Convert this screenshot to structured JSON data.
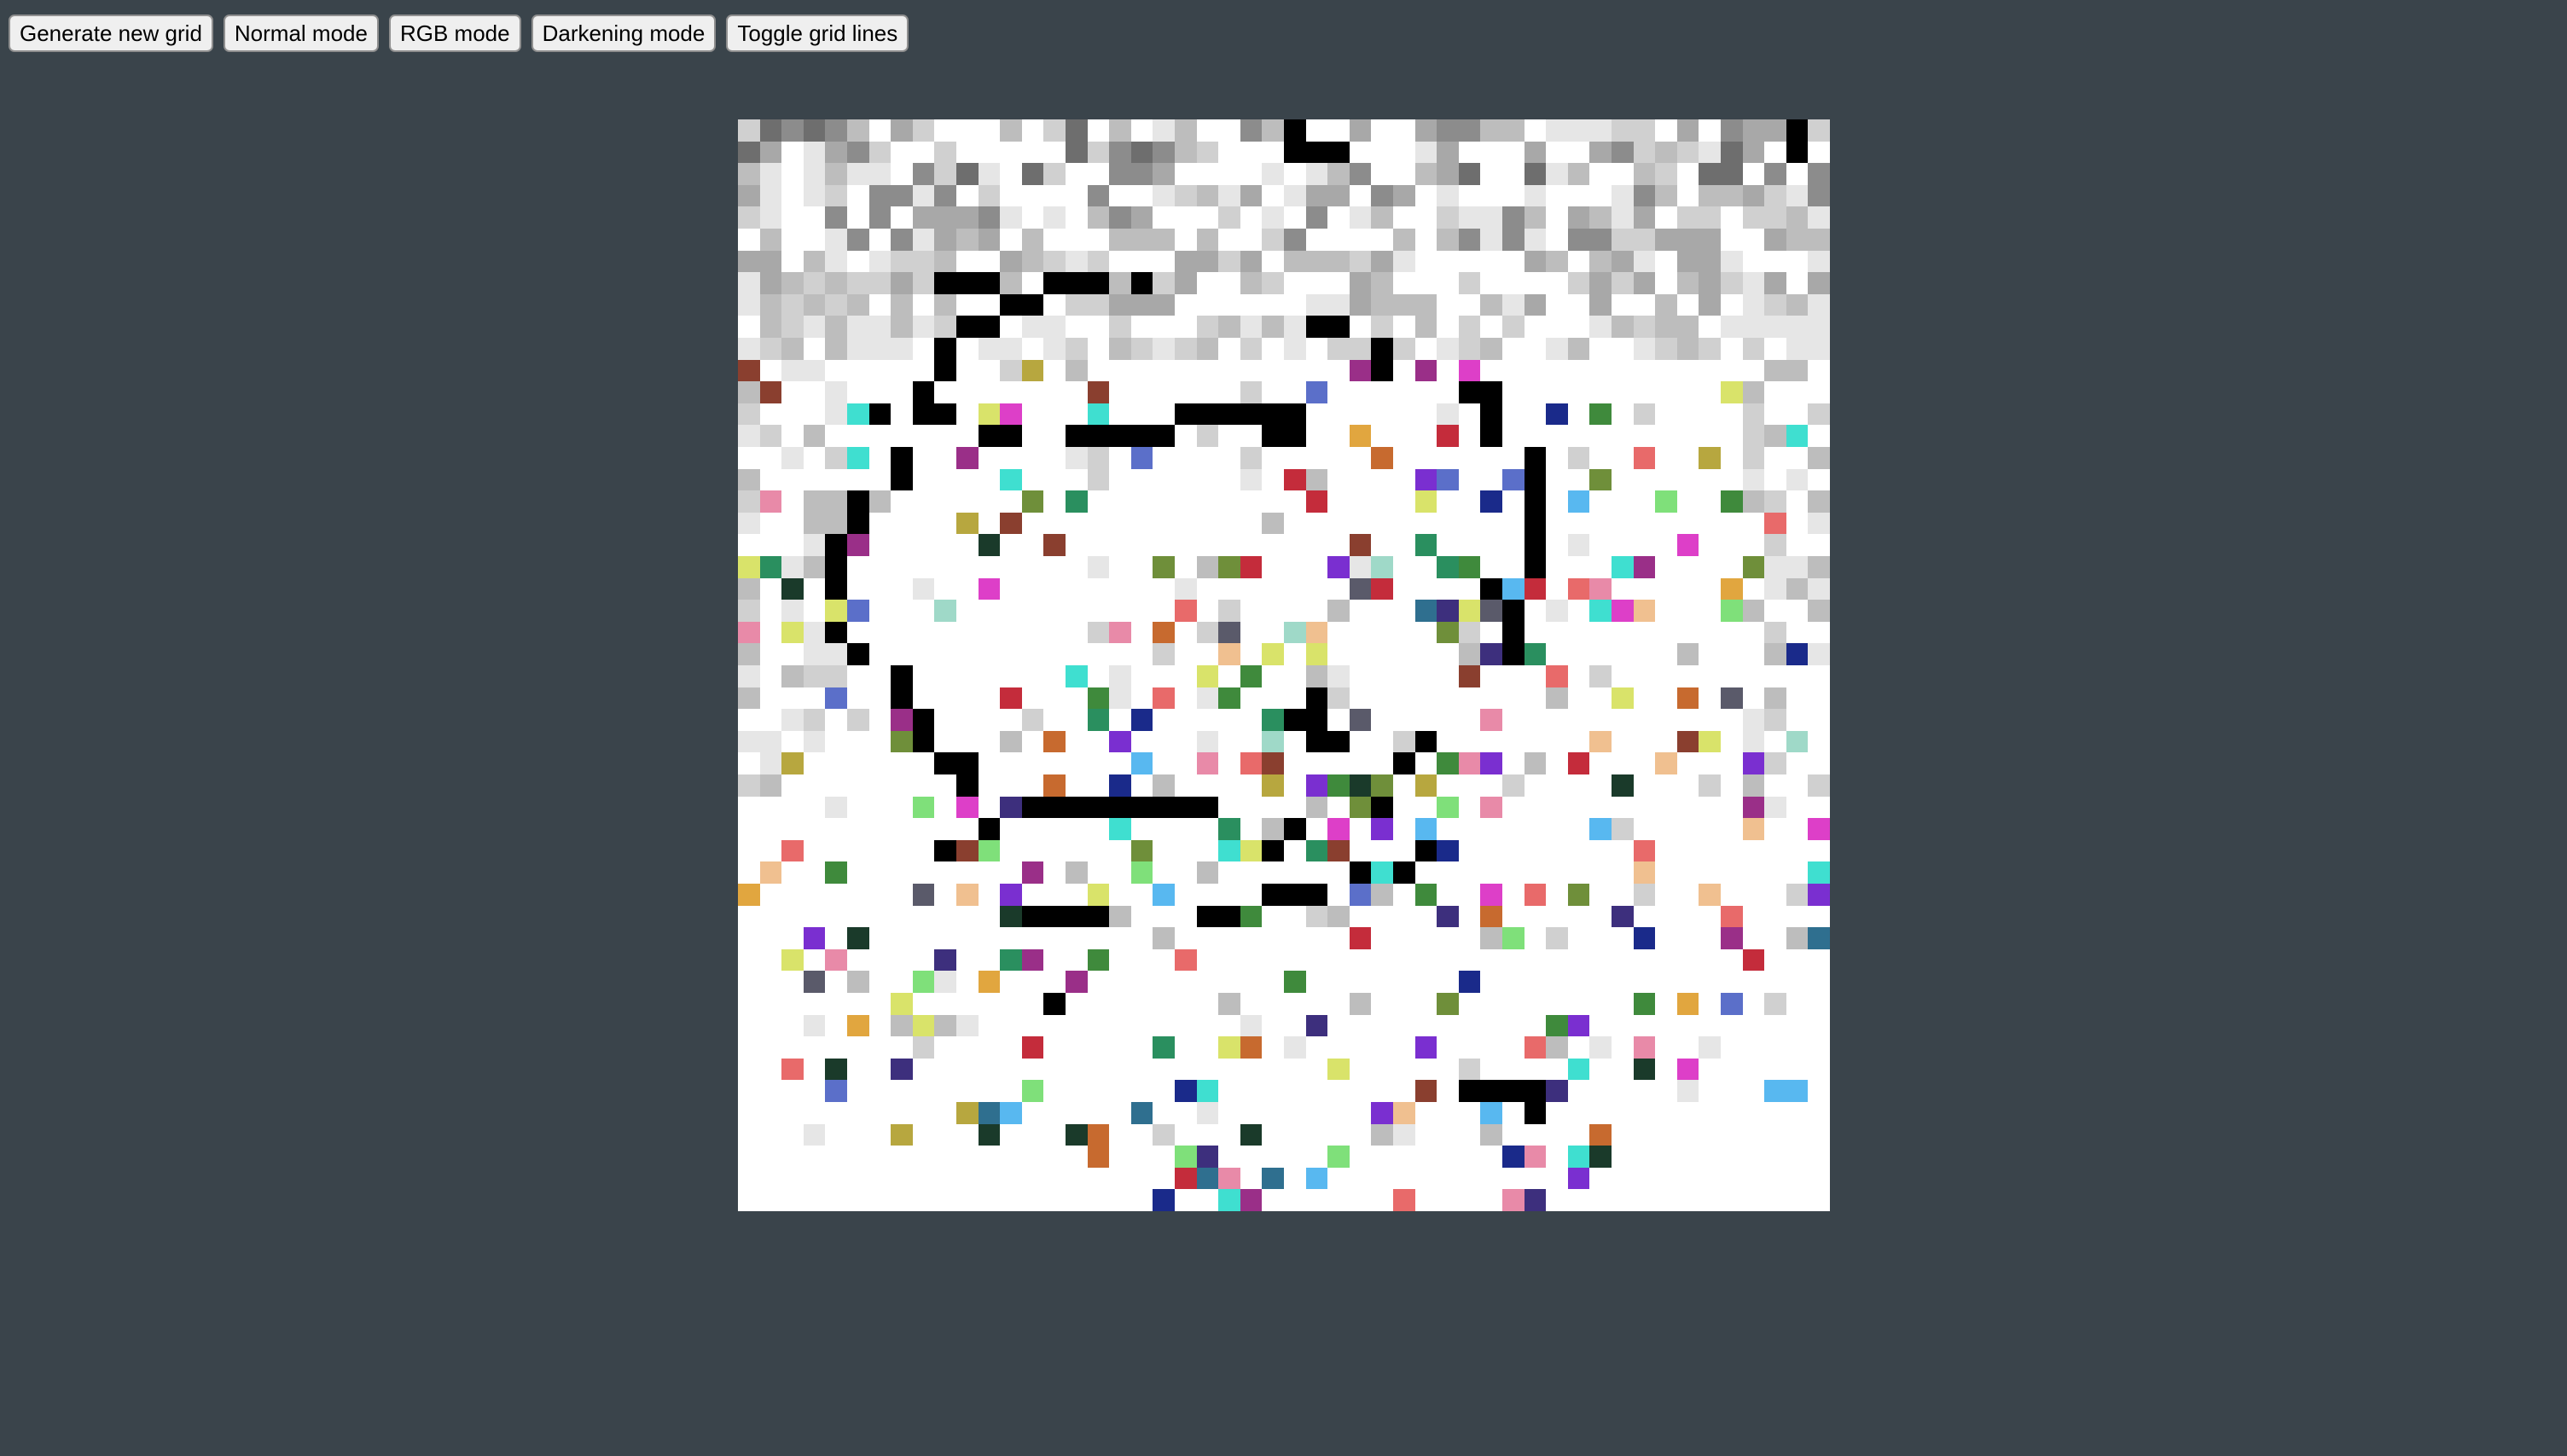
{
  "toolbar": {
    "buttons": [
      {
        "id": "generate",
        "label": "Generate new grid"
      },
      {
        "id": "normal",
        "label": "Normal mode"
      },
      {
        "id": "rgb",
        "label": "RGB mode"
      },
      {
        "id": "darken",
        "label": "Darkening mode"
      },
      {
        "id": "gridlines",
        "label": "Toggle grid lines"
      }
    ]
  },
  "grid": {
    "rows": 50,
    "cols": 50,
    "background": "#ffffff",
    "drawing_colors": {
      "black": "#000000",
      "palette": [
        "#5b6fc9",
        "#e88aa8",
        "#3f8a3c",
        "#7a2fd0",
        "#c42c3b",
        "#b7a73f",
        "#9a2f88",
        "#58b8f0",
        "#d9e36a",
        "#2a8f5f",
        "#1a2a8a",
        "#e1a63f",
        "#7fe07a",
        "#3d2f7d",
        "#c76a2f",
        "#dd3fc8",
        "#8a3f2f",
        "#2f6f8f",
        "#9fd9c8",
        "#5a5a6a",
        "#e86a6a",
        "#6f8f3a",
        "#3fdfd0",
        "#f0c090",
        "#1a3a2a"
      ],
      "grays": [
        "#e6e6e6",
        "#d0d0d0",
        "#bdbdbd",
        "#a8a8a8",
        "#8c8c8c",
        "#6e6e6e",
        "#4a4a4a",
        "#2a2a2a"
      ]
    }
  }
}
